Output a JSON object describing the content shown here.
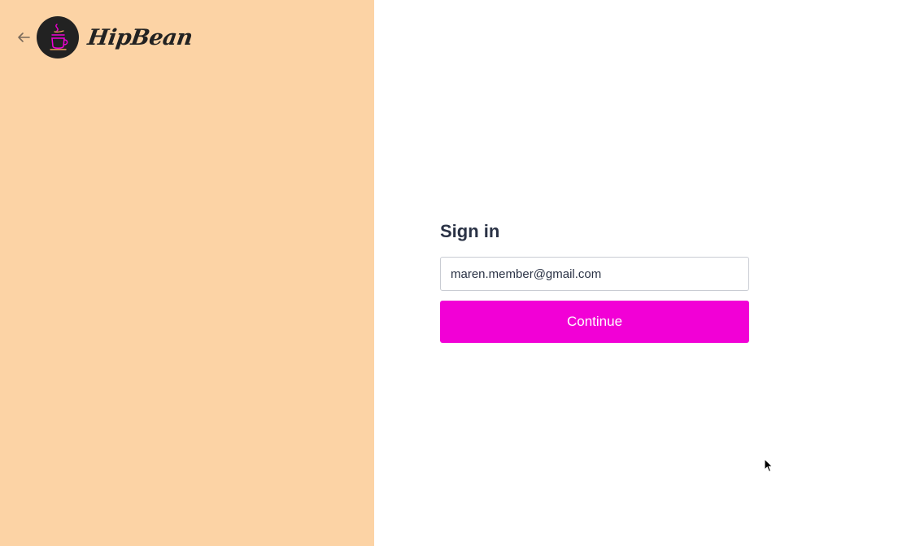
{
  "brand": {
    "name": "HipBean",
    "icon": "coffee-cup-icon",
    "panel_color": "#fcd3a5",
    "accent": "#f200d6"
  },
  "nav": {
    "back_icon": "arrow-left-icon"
  },
  "signin": {
    "title": "Sign in",
    "email_value": "maren.member@gmail.com",
    "continue_label": "Continue"
  }
}
